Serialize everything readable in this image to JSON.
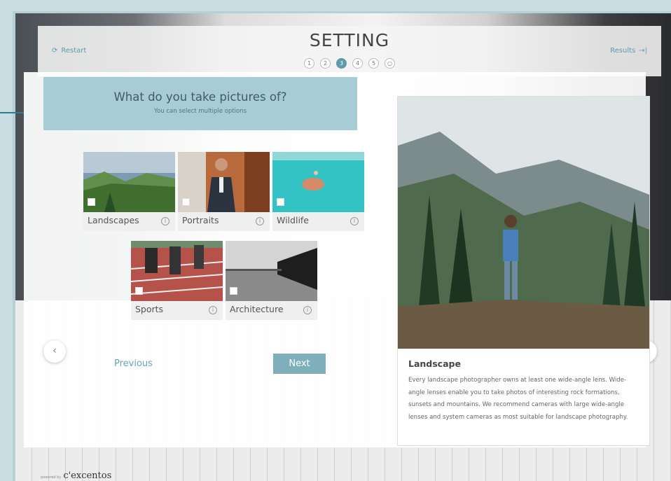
{
  "header": {
    "restart_label": "Restart",
    "title": "SETTING",
    "results_label": "Results",
    "steps": [
      "1",
      "2",
      "3",
      "4",
      "5",
      "○"
    ],
    "active_step": 3
  },
  "question": {
    "title": "What do you take pictures of?",
    "subtitle": "You can select multiple options"
  },
  "options": [
    {
      "label": "Landscapes",
      "checked": false
    },
    {
      "label": "Portraits",
      "checked": false
    },
    {
      "label": "Wildlife",
      "checked": false
    },
    {
      "label": "Sports",
      "checked": false
    },
    {
      "label": "Architecture",
      "checked": false
    }
  ],
  "nav": {
    "previous_label": "Previous",
    "next_label": "Next",
    "left_arrow": "‹",
    "right_arrow": "›"
  },
  "detail": {
    "title": "Landscape",
    "description": "Every landscape photographer owns at least one wide-angle lens. Wide-angle lenses enable you to take photos of interesting rock formations, sunsets and mountains. We recommend cameras with large wide-angle lenses and system cameras as most suitable for landscape photography."
  },
  "footer": {
    "powered_by": "powered by",
    "brand": "c'excentos"
  },
  "colors": {
    "accent": "#5d9aab",
    "question_bg": "#a8ccd6",
    "next_button": "#7fafbb",
    "pointer": "#2f7c8f"
  }
}
